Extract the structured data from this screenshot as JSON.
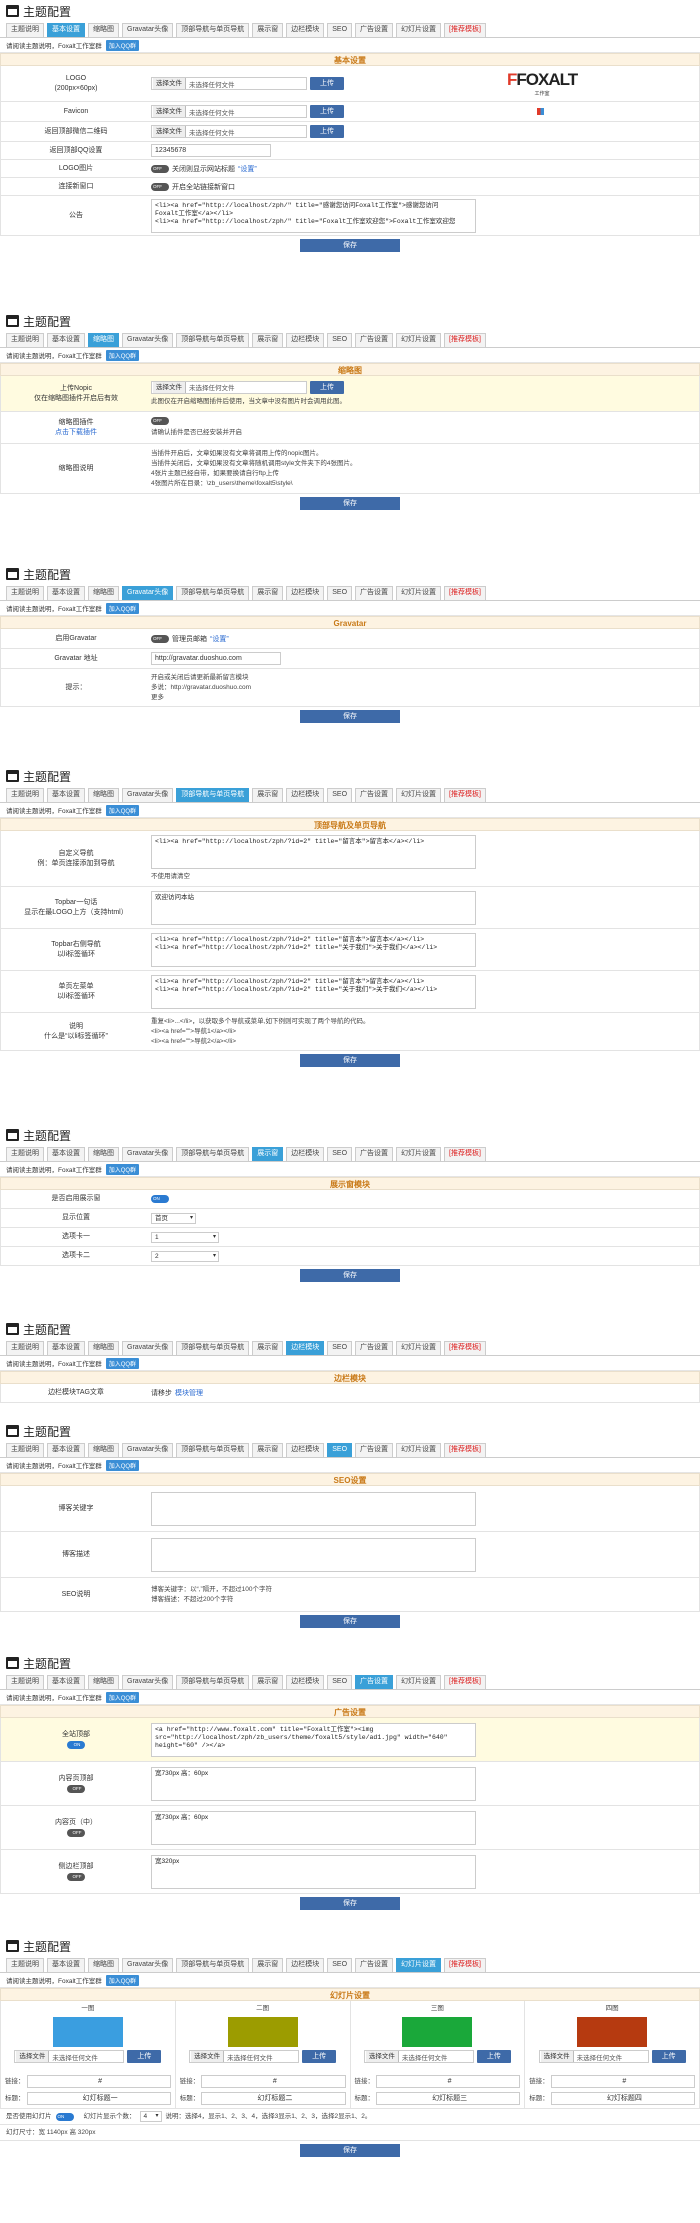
{
  "header_title": "主题配置",
  "tabs": [
    "主题说明",
    "基本设置",
    "缩略图",
    "Gravatar头像",
    "顶部导航与单页导航",
    "展示窗",
    "边栏模块",
    "SEO",
    "广告设置",
    "幻灯片设置",
    "[推荐模板]"
  ],
  "notice": "请阅读主题说明，Foxalt工作室群",
  "qq": "加入QQ群",
  "save": "保存",
  "choose": "选择文件",
  "nofile": "未选择任何文件",
  "upload": "上传",
  "basic": {
    "title": "基本设置",
    "logo_label": "LOGO",
    "logo_size": "(200px×60px)",
    "favicon_label": "Favicon",
    "qr_label": "返回顶部微信二维码",
    "qq_label": "返回顶部QQ设置",
    "qq_value": "12345678",
    "logo_img_label": "LOGO图片",
    "logo_img_text": "关闭则显示网站标题",
    "settings_link": "“设置”",
    "newwin_label": "连接新窗口",
    "newwin_text": "开启全站链接新窗口",
    "notice_label": "公告",
    "notice_text": "<li><a href=\"http://localhost/zph/\" title=\"感谢您访问Foxalt工作室\">感谢您访问\nFoxalt工作室</a></li>\n<li><a href=\"http://localhost/zph/\" title=\"Foxalt工作室欢迎您\">Foxalt工作室欢迎您",
    "brand": "FOXALT",
    "brand_sub": "工作室"
  },
  "thumb": {
    "title": "缩略图",
    "nopic_label": "上传Nopic",
    "nopic_sub": "仅在缩略图插件开启后有效",
    "nopic_desc": "此图仅在开启缩略图插件后使用，当文章中没有图片时会调用此图。",
    "plugin_label": "缩略图插件",
    "plugin_link": "点击下载插件",
    "plugin_desc": "请确认插件是否已经安装并开启",
    "desc_label": "缩略图说明",
    "desc_lines": [
      "当插件开启后，文章如果没有文章将调用上传的nopic图片。",
      "当插件关闭后，文章如果没有文章将随机调用style文件夹下的4张图片。",
      "4张片主题已经自带，如果要换请自行ftp上传",
      "4张图片所在目录：\\zb_users\\theme\\foxalt5\\style\\"
    ]
  },
  "gravatar": {
    "title": "Gravatar",
    "use_label": "启用Gravatar",
    "use_text": "管理员邮箱",
    "use_link": "“设置”",
    "addr_label": "Gravatar 地址",
    "addr_value": "http://gravatar.duoshuo.com",
    "tip_label": "提示：",
    "tip_lines": [
      "开启或关闭后请更新最新留言模块",
      "多说：http://gravatar.duoshuo.com"
    ],
    "tip_more": "更多"
  },
  "nav": {
    "title": "顶部导航及单页导航",
    "custom_label": "自定义导航",
    "custom_sub": "例：单页连接添加到导航",
    "custom_text": "<li><a href=\"http://localhost/zph/?id=2\" title=\"留言本\">留言本</a></li>",
    "custom_note": "不使用请清空",
    "topbar_label": "Topbar一句话",
    "topbar_sub": "显示在最LOGO上方（支持html）",
    "topbar_value": "欢迎访问本站",
    "right_label": "Topbar右侧导航",
    "right_sub": "以li标签循环",
    "right_text": "<li><a href=\"http://localhost/zph/?id=2\" title=\"留言本\">留言本</a></li>\n<li><a href=\"http://localhost/zph/?id=2\" title=\"关于我们\">关于我们</a></li>",
    "page_label": "单页左菜单",
    "page_sub": "以li标签循环",
    "page_text": "<li><a href=\"http://localhost/zph/?id=2\" title=\"留言本\">留言本</a></li>\n<li><a href=\"http://localhost/zph/?id=2\" title=\"关于我们\">关于我们</a></li>",
    "desc_label": "说明",
    "desc_sub": "什么是“以li标签循环”",
    "desc_lines": [
      "重复<li>...</li>，以获取多个导航或菜单,如下例则可实现了两个导航的代码。",
      "<li><a href=\"\">导航1</a></li>",
      "<li><a href=\"\">导航2</a></li>"
    ]
  },
  "show": {
    "title": "展示窗模块",
    "enable_label": "是否启用展示窗",
    "pos_label": "显示位置",
    "pos_value": "首页",
    "card1_label": "选项卡一",
    "card1_value": "1",
    "card2_label": "选项卡二",
    "card2_value": "2"
  },
  "side": {
    "title": "边栏模块",
    "tag_label": "边栏模块TAG文章",
    "tag_text": "请移步",
    "tag_link": "模块管理"
  },
  "seo": {
    "title": "SEO设置",
    "kw_label": "博客关键字",
    "desc_label": "博客描述",
    "info_label": "SEO说明",
    "info_lines": [
      "博客关键字：以“,”隔开，不超过100个字符",
      "博客描述：不超过200个字符"
    ]
  },
  "ad": {
    "title": "广告设置",
    "top_label": "全站顶部",
    "top_text": "<a href=\"http://www.foxalt.com\" title=\"Foxalt工作室\"><img\nsrc=\"http://localhost/zph/zb_users/theme/foxalt5/style/ad1.jpg\" width=\"640\"\nheight=\"60\" /></a>",
    "inner_label": "内容页顶部",
    "inner_text": "宽730px 高：60px",
    "mid_label": "内容页（中）",
    "mid_text": "宽730px 高：60px",
    "side_label": "侧边栏顶部",
    "side_text": "宽320px"
  },
  "slide": {
    "title": "幻灯片设置",
    "cols": [
      {
        "head": "一图",
        "color": "#3a9ee0",
        "link": "#",
        "label": "幻灯标题一"
      },
      {
        "head": "二图",
        "color": "#9c9c00",
        "link": "#",
        "label": "幻灯标题二"
      },
      {
        "head": "三图",
        "color": "#1aa83a",
        "link": "#",
        "label": "幻灯标题三"
      },
      {
        "head": "四图",
        "color": "#b63a10",
        "link": "#",
        "label": "幻灯标题四"
      }
    ],
    "link_label": "链接：",
    "title_label": "标题：",
    "use_label": "是否使用幻灯片",
    "count_label": "幻灯片显示个数：",
    "count_value": "4",
    "count_desc": "说明：选择4，显示1、2、3、4，选择3显示1、2、3，选择2显示1、2。",
    "size": "幻灯尺寸：宽 1140px 高 320px"
  }
}
